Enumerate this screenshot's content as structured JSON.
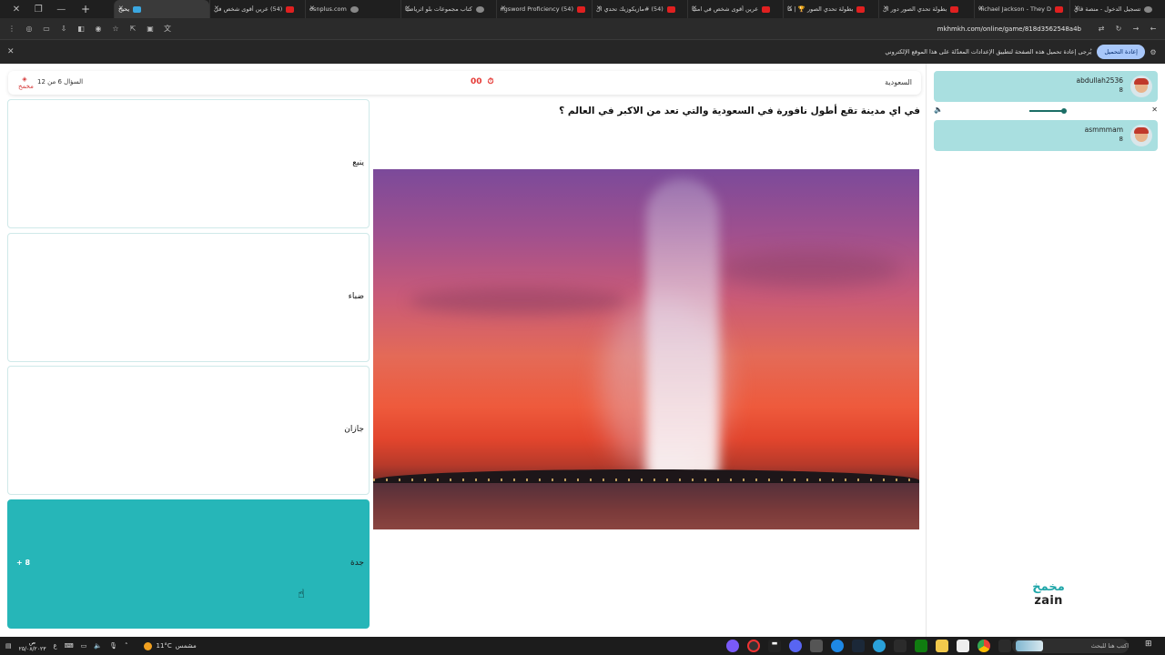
{
  "browser": {
    "tabs": [
      {
        "title": "تسجيل الدخول - منصة ڤاي",
        "fav": "gray"
      },
      {
        "title": "Michael Jackson - They D",
        "fav": "yt"
      },
      {
        "title": "بطولة تحدي الصور دور ال",
        "fav": "yt"
      },
      {
        "title": "بطولة تحدي الصور 🏆 | ما",
        "fav": "yt"
      },
      {
        "title": "عرين أقوى شخص في امنيا",
        "fav": "yt"
      },
      {
        "title": "(54) #مازيكوزيك تحدي ال",
        "fav": "yt"
      },
      {
        "title": "(54) Longsword Proficiency",
        "fav": "yt"
      },
      {
        "title": "كتاب مجموعات بلو اثرياضيا",
        "fav": "gray"
      },
      {
        "title": "osnplus.com",
        "fav": "gray"
      },
      {
        "title": "(54) عرين أقوى شخص في",
        "fav": "yt"
      },
      {
        "title": "يحيخ",
        "fav": "blue",
        "active": true
      }
    ],
    "url": "mkhmkh.com/online/game/818d3562548a4b",
    "infobar_message": "يُرجى إعادة تحميل هذه الصفحة لتطبيق الإعدادات المعدّلة على هذا الموقع الإلكتروني",
    "reload_label": "إعادة التحميل"
  },
  "game": {
    "question_counter": "السؤال 6 من 12",
    "logo_text": "مخمخ",
    "timer": "00",
    "category": "السعودية",
    "question": "في اي مدينة تقع أطول نافورة في السعودية والتي تعد من الاكبر في العالم ؟",
    "answers": [
      {
        "label": "ينبع"
      },
      {
        "label": "ضباء"
      },
      {
        "label": "جازان"
      },
      {
        "label": "جدة",
        "points": "+ 8"
      }
    ]
  },
  "players": [
    {
      "name": "abdullah2536",
      "score": "8"
    },
    {
      "name": "asmmmam",
      "score": "8"
    }
  ],
  "brand": {
    "arabic": "مخمخ",
    "sponsor": "zain"
  },
  "taskbar": {
    "time": "ص",
    "date": "٢٥/٠٨/٢٠٢٣",
    "weather_temp": "11°C",
    "weather_label": "مشمس",
    "search_placeholder": "اكتب هنا للبحث"
  },
  "colors": {
    "accent": "#26b6b8",
    "player_bg": "#a9dfe0",
    "timer": "#e53935"
  }
}
